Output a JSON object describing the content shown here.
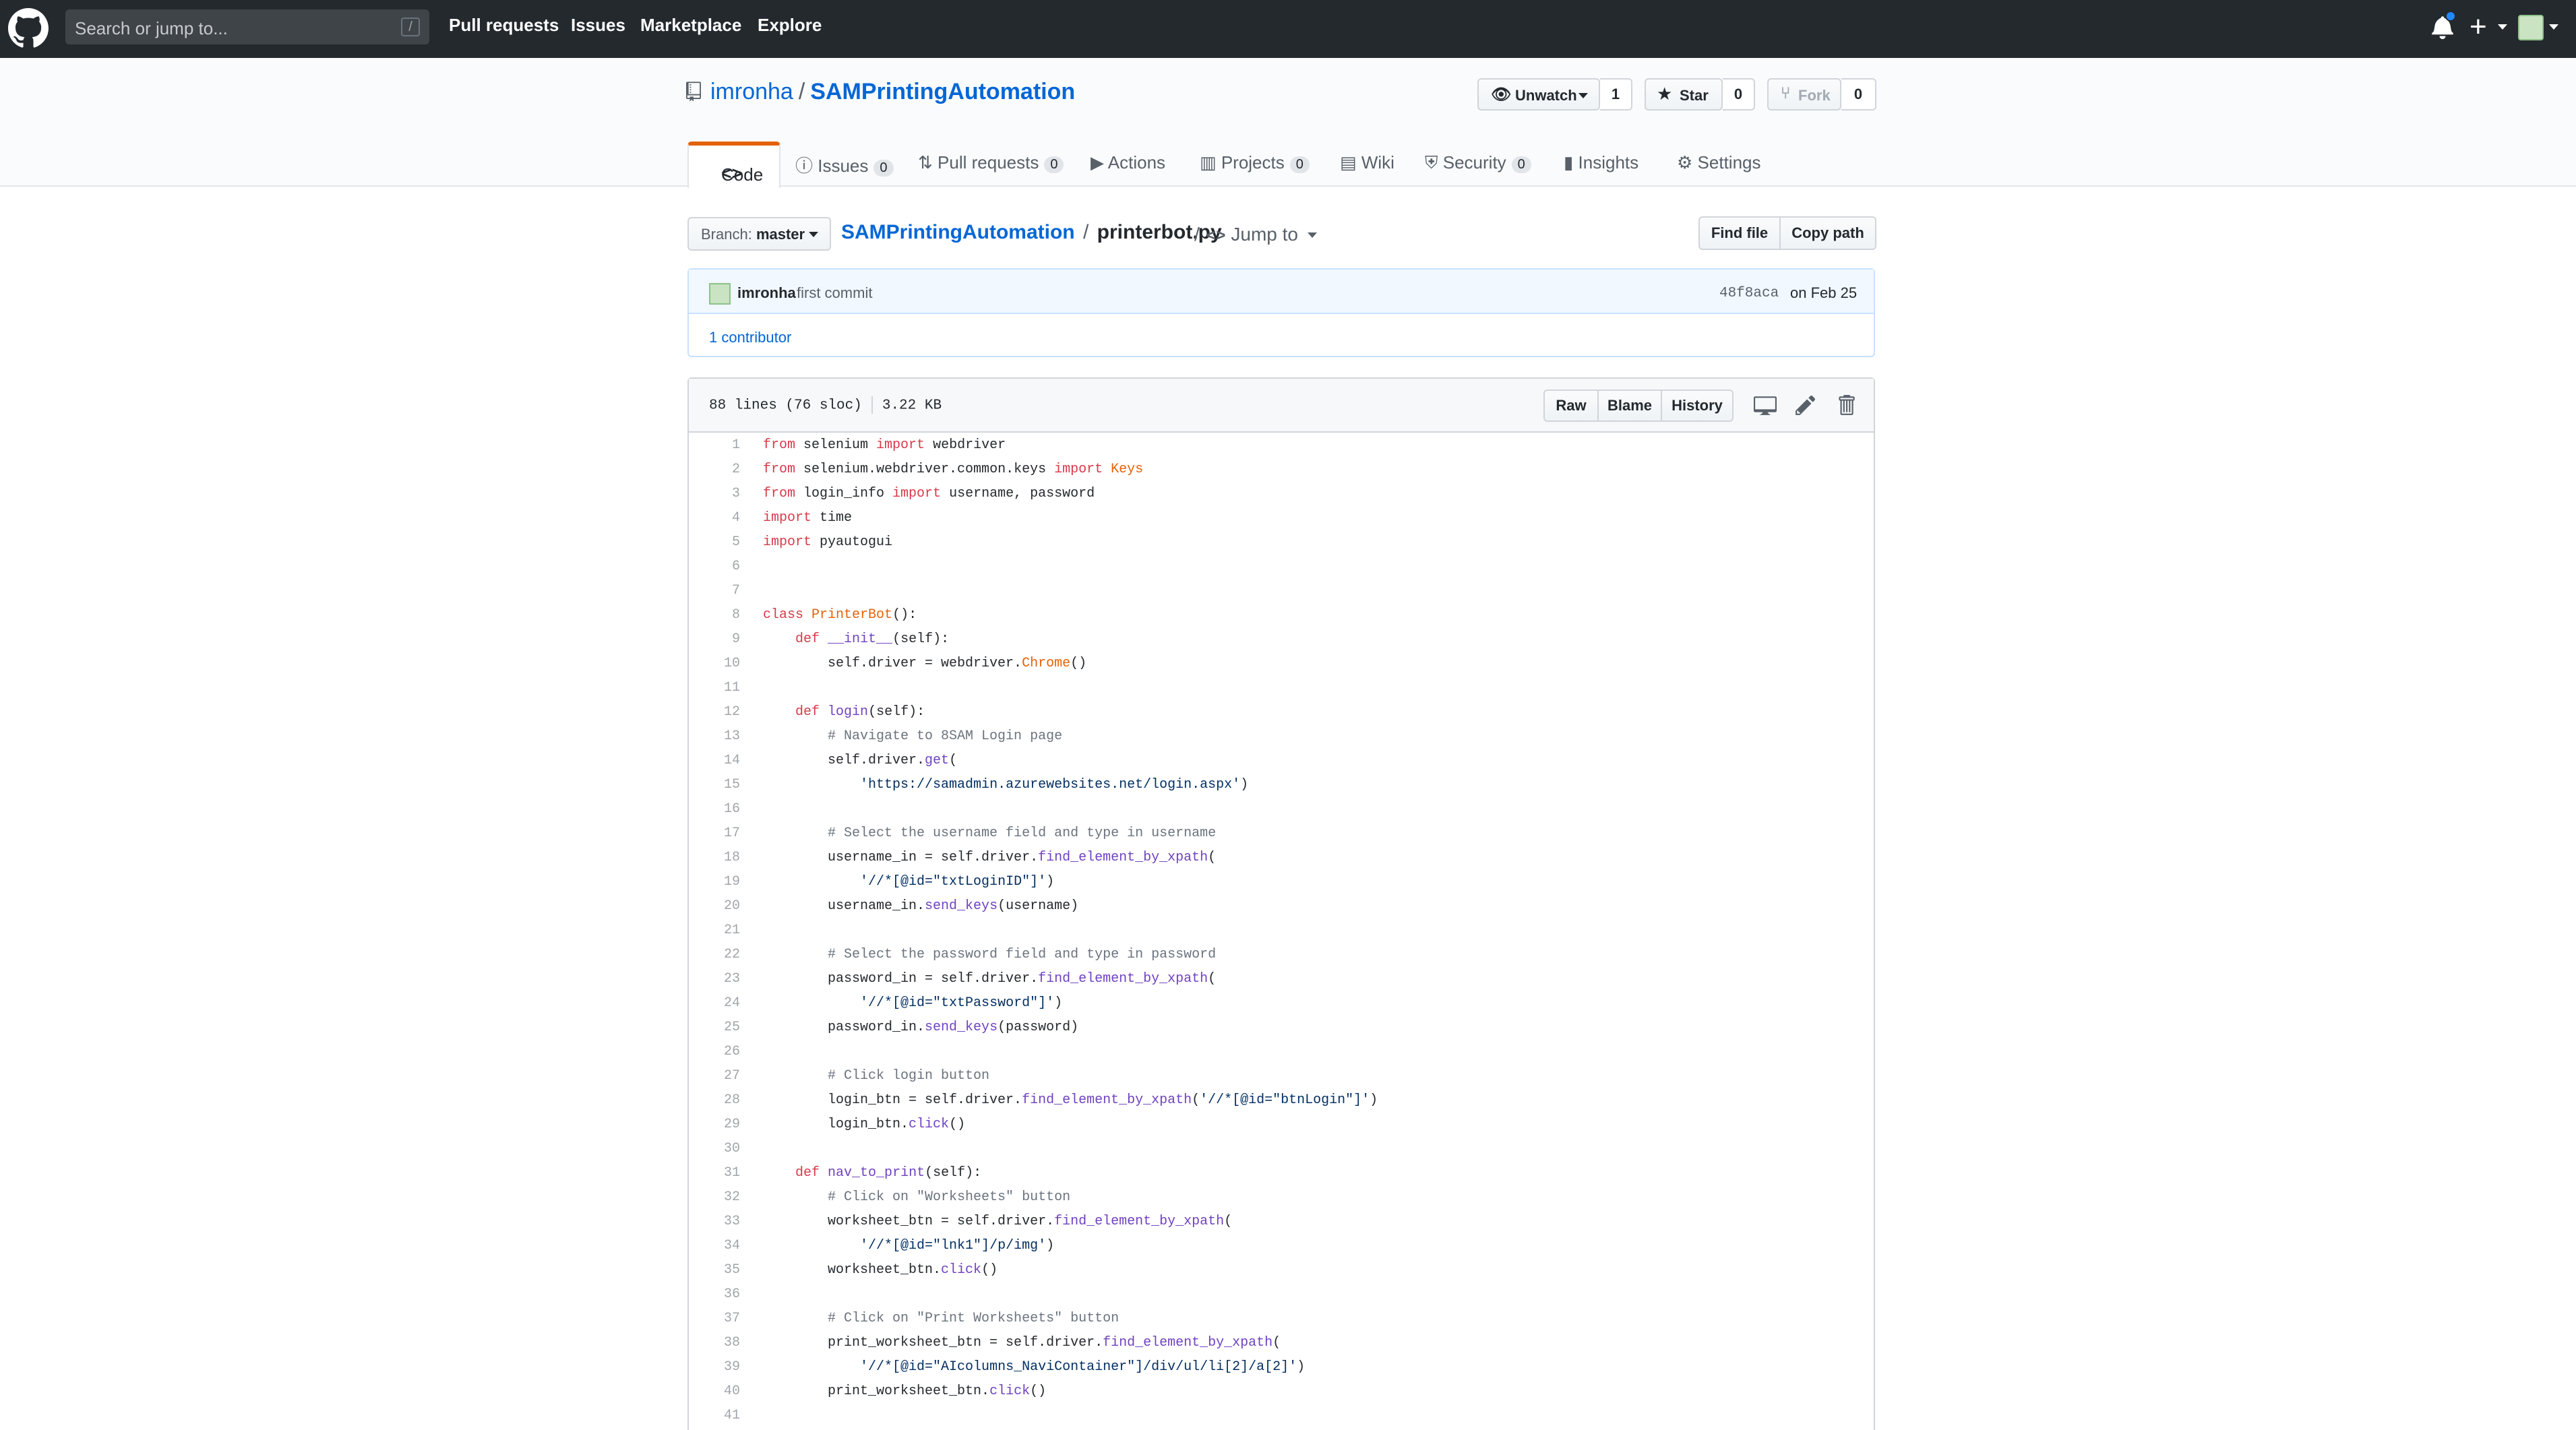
{
  "header": {
    "search_placeholder": "Search or jump to...",
    "search_shortcut": "/",
    "nav": [
      "Pull requests",
      "Issues",
      "Marketplace",
      "Explore"
    ]
  },
  "repo": {
    "owner": "imronha",
    "name": "SAMPrintingAutomation",
    "unwatch_label": "Unwatch",
    "watch_count": "1",
    "star_label": "Star",
    "star_count": "0",
    "fork_label": "Fork",
    "fork_count": "0"
  },
  "tabs": [
    {
      "label": "Code",
      "count": null
    },
    {
      "label": "Issues",
      "count": "0"
    },
    {
      "label": "Pull requests",
      "count": "0"
    },
    {
      "label": "Actions",
      "count": null
    },
    {
      "label": "Projects",
      "count": "0"
    },
    {
      "label": "Wiki",
      "count": null
    },
    {
      "label": "Security",
      "count": "0"
    },
    {
      "label": "Insights",
      "count": null
    },
    {
      "label": "Settings",
      "count": null
    }
  ],
  "file_nav": {
    "branch_prefix": "Branch:",
    "branch": "master",
    "root": "SAMPrintingAutomation",
    "separator": "/",
    "filename": "printerbot.py",
    "jump_to": "Jump to",
    "find_file": "Find file",
    "copy_path": "Copy path"
  },
  "commit": {
    "author": "imronha",
    "message": "first commit",
    "sha": "48f8aca",
    "date": "on Feb 25",
    "contributors": "1 contributor"
  },
  "file": {
    "lines_info": "88 lines (76 sloc)",
    "size": "3.22 KB",
    "raw": "Raw",
    "blame": "Blame",
    "history": "History"
  },
  "code_lines": [
    "from selenium import webdriver",
    "from selenium.webdriver.common.keys import Keys",
    "from login_info import username, password",
    "import time",
    "import pyautogui",
    "",
    "",
    "class PrinterBot():",
    "    def __init__(self):",
    "        self.driver = webdriver.Chrome()",
    "",
    "    def login(self):",
    "        # Navigate to 8SAM Login page",
    "        self.driver.get(",
    "            'https://samadmin.azurewebsites.net/login.aspx')",
    "",
    "        # Select the username field and type in username",
    "        username_in = self.driver.find_element_by_xpath(",
    "            '//*[@id=\"txtLoginID\"]')",
    "        username_in.send_keys(username)",
    "",
    "        # Select the password field and type in password",
    "        password_in = self.driver.find_element_by_xpath(",
    "            '//*[@id=\"txtPassword\"]')",
    "        password_in.send_keys(password)",
    "",
    "        # Click login button",
    "        login_btn = self.driver.find_element_by_xpath('//*[@id=\"btnLogin\"]')",
    "        login_btn.click()",
    "",
    "    def nav_to_print(self):",
    "        # Click on \"Worksheets\" button",
    "        worksheet_btn = self.driver.find_element_by_xpath(",
    "            '//*[@id=\"lnk1\"]/p/img')",
    "        worksheet_btn.click()",
    "",
    "        # Click on \"Print Worksheets\" button",
    "        print_worksheet_btn = self.driver.find_element_by_xpath(",
    "            '//*[@id=\"AIcolumns_NaviContainer\"]/div/ul/li[2]/a[2]')",
    "        print_worksheet_btn.click()",
    ""
  ]
}
